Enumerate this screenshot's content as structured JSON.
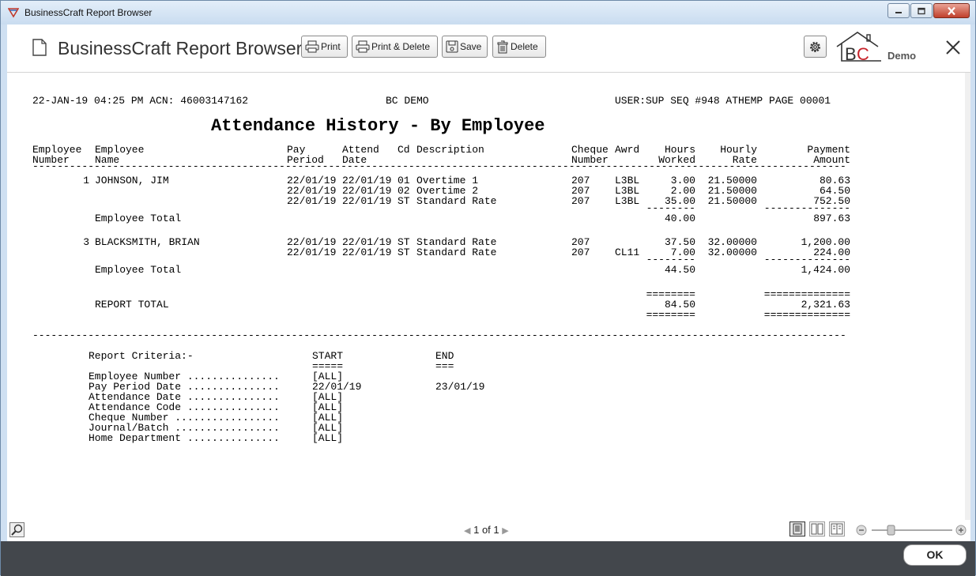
{
  "window": {
    "title": "BusinessCraft Report Browser"
  },
  "toolbar": {
    "app_title": "BusinessCraft Report Browser",
    "print": "Print",
    "print_delete": "Print & Delete",
    "save": "Save",
    "delete": "Delete",
    "brand": "BC",
    "demo": "Demo"
  },
  "report": {
    "header_left": "22-JAN-19 04:25 PM ACN: 46003147162",
    "header_center": "BC DEMO",
    "header_right": "USER:SUP SEQ #948 ATHEMP PAGE 00001",
    "title": "Attendance History - By Employee",
    "columns": {
      "emp_number": [
        "Employee",
        "Number"
      ],
      "emp_name": [
        "Employee",
        "Name"
      ],
      "pay_period": [
        "Pay",
        "Period"
      ],
      "attend_date": [
        "Attend",
        "Date"
      ],
      "cd": "Cd",
      "description": "Description",
      "cheque": [
        "Cheque",
        "Number"
      ],
      "awrd": "Awrd",
      "hours": [
        "Hours",
        "Worked"
      ],
      "rate": [
        "Hourly",
        "Rate"
      ],
      "payment": [
        "Payment",
        "Amount"
      ]
    },
    "rule_line": "---------------------------------------------------------------------------------------------------------------------------------------------------------------------------------",
    "employees": [
      {
        "number": "1",
        "name": "JOHNSON, JIM",
        "rows": [
          {
            "pay": "22/01/19",
            "attend": "22/01/19",
            "cd": "01",
            "desc": "Overtime 1",
            "cheque": "207",
            "awrd": "L3BL",
            "hours": "3.00",
            "rate": "21.50000",
            "amount": "80.63"
          },
          {
            "pay": "22/01/19",
            "attend": "22/01/19",
            "cd": "02",
            "desc": "Overtime 2",
            "cheque": "207",
            "awrd": "L3BL",
            "hours": "2.00",
            "rate": "21.50000",
            "amount": "64.50"
          },
          {
            "pay": "22/01/19",
            "attend": "22/01/19",
            "cd": "ST",
            "desc": "Standard Rate",
            "cheque": "207",
            "awrd": "L3BL",
            "hours": "35.00",
            "rate": "21.50000",
            "amount": "752.50"
          }
        ],
        "total_label": "Employee Total",
        "total_hours": "40.00",
        "total_amount": "897.63"
      },
      {
        "number": "3",
        "name": "BLACKSMITH, BRIAN",
        "rows": [
          {
            "pay": "22/01/19",
            "attend": "22/01/19",
            "cd": "ST",
            "desc": "Standard Rate",
            "cheque": "207",
            "awrd": "",
            "hours": "37.50",
            "rate": "32.00000",
            "amount": "1,200.00"
          },
          {
            "pay": "22/01/19",
            "attend": "22/01/19",
            "cd": "ST",
            "desc": "Standard Rate",
            "cheque": "207",
            "awrd": "CL11",
            "hours": "7.00",
            "rate": "32.00000",
            "amount": "224.00"
          }
        ],
        "total_label": "Employee Total",
        "total_hours": "44.50",
        "total_amount": "1,424.00"
      }
    ],
    "report_total_label": "REPORT TOTAL",
    "report_total_hours": "84.50",
    "report_total_amount": "2,321.63",
    "dash_short": "--------",
    "dash_long": "--------------",
    "eq_short": "========",
    "eq_long": "==============",
    "criteria": {
      "title": "Report Criteria:-",
      "start_label": "START",
      "end_label": "END",
      "start_underline": "=====",
      "end_underline": "===",
      "items": [
        {
          "label": "Employee Number ...............",
          "start": "[ALL]",
          "end": ""
        },
        {
          "label": "Pay Period Date ...............",
          "start": "22/01/19",
          "end": "23/01/19"
        },
        {
          "label": "Attendance Date ...............",
          "start": "[ALL]",
          "end": ""
        },
        {
          "label": "Attendance Code ...............",
          "start": "[ALL]",
          "end": ""
        },
        {
          "label": "Cheque Number .................",
          "start": "[ALL]",
          "end": ""
        },
        {
          "label": "Journal/Batch .................",
          "start": "[ALL]",
          "end": ""
        },
        {
          "label": "Home Department ...............",
          "start": "[ALL]",
          "end": ""
        }
      ]
    }
  },
  "footer": {
    "page": "1",
    "of": "of",
    "total": "1"
  },
  "ok": "OK"
}
